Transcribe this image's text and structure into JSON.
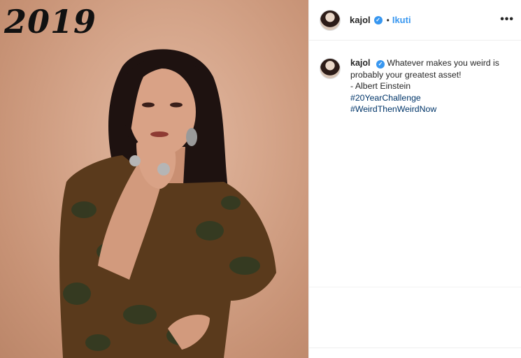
{
  "photo": {
    "year_text": "2019"
  },
  "post": {
    "username": "kajol",
    "follow_label": "Ikuti",
    "more_icon": "ellipsis-icon",
    "verified_icon": "verified-badge-icon",
    "caption_username": "kajol",
    "caption_lines": [
      "Whatever makes you weird is probably your greatest asset!",
      "- Albert Einstein"
    ],
    "hashtags": [
      "#20YearChallenge",
      "#WeirdThenWeirdNow"
    ]
  },
  "colors": {
    "accent": "#3897f0",
    "hashtag": "#003569",
    "backdrop": "#d5a58a"
  }
}
